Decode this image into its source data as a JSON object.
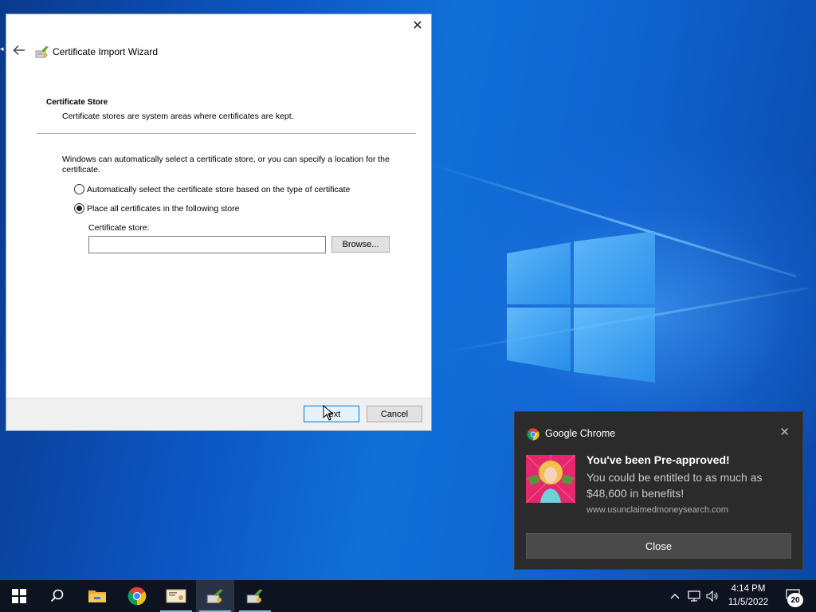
{
  "dialog": {
    "title": "Certificate Import Wizard",
    "section_title": "Certificate Store",
    "section_desc": "Certificate stores are system areas where certificates are kept.",
    "intro": "Windows can automatically select a certificate store, or you can specify a location for the certificate.",
    "options": [
      {
        "label": "Automatically select the certificate store based on the type of certificate",
        "selected": false
      },
      {
        "label": "Place all certificates in the following store",
        "selected": true
      }
    ],
    "store_label": "Certificate store:",
    "store_value": "",
    "browse_label": "Browse...",
    "next_label": "Next",
    "cancel_label": "Cancel"
  },
  "toast": {
    "app_name": "Google Chrome",
    "headline": "You've been Pre-approved!",
    "body": "You could be entitled to as much as $48,600 in benefits!",
    "url": "www.usunclaimedmoneysearch.com",
    "close_label": "Close",
    "close_icon": "✕"
  },
  "taskbar": {
    "items": [
      {
        "icon": "windows-start-icon"
      },
      {
        "icon": "search-icon"
      },
      {
        "icon": "file-explorer-icon"
      },
      {
        "icon": "chrome-icon"
      },
      {
        "icon": "certificate-manager-icon"
      },
      {
        "icon": "certificate-wizard-icon",
        "active": true
      },
      {
        "icon": "certificate-wizard-icon-2"
      }
    ],
    "time": "4:14 PM",
    "date": "11/5/2022",
    "notification_count": "20"
  },
  "colors": {
    "accent": "#0078d7",
    "taskbar_bg": "#0d1320",
    "toast_bg": "#2b2b2b"
  }
}
